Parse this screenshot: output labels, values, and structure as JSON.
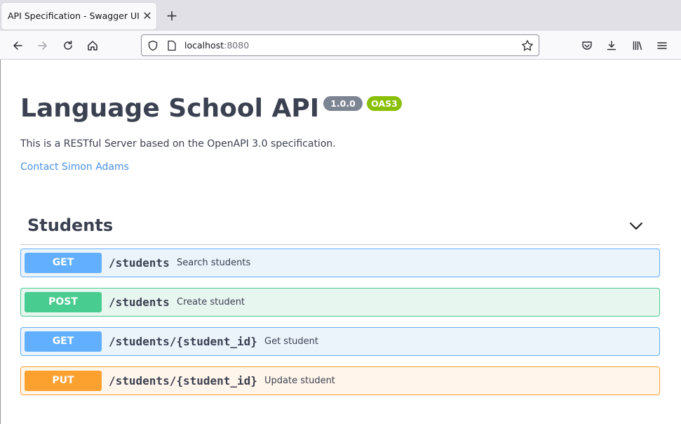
{
  "browser": {
    "tab_title": "API Specification - Swagger UI",
    "url_host": "localhost",
    "url_port": ":8080"
  },
  "info": {
    "title": "Language School API",
    "version": "1.0.0",
    "oas_badge": "OAS3",
    "description": "This is a RESTful Server based on the OpenAPI 3.0 specification.",
    "contact_label": "Contact Simon Adams"
  },
  "tag": {
    "name": "Students",
    "operations": [
      {
        "method": "GET",
        "path": "/students",
        "summary": "Search students"
      },
      {
        "method": "POST",
        "path": "/students",
        "summary": "Create student"
      },
      {
        "method": "GET",
        "path": "/students/{student_id}",
        "summary": "Get student"
      },
      {
        "method": "PUT",
        "path": "/students/{student_id}",
        "summary": "Update student"
      }
    ]
  },
  "colors": {
    "get": "#61affe",
    "post": "#49cc90",
    "put": "#fca130",
    "link": "#4990e2",
    "version_badge": "#7d8492",
    "oas_badge": "#89bf04"
  }
}
